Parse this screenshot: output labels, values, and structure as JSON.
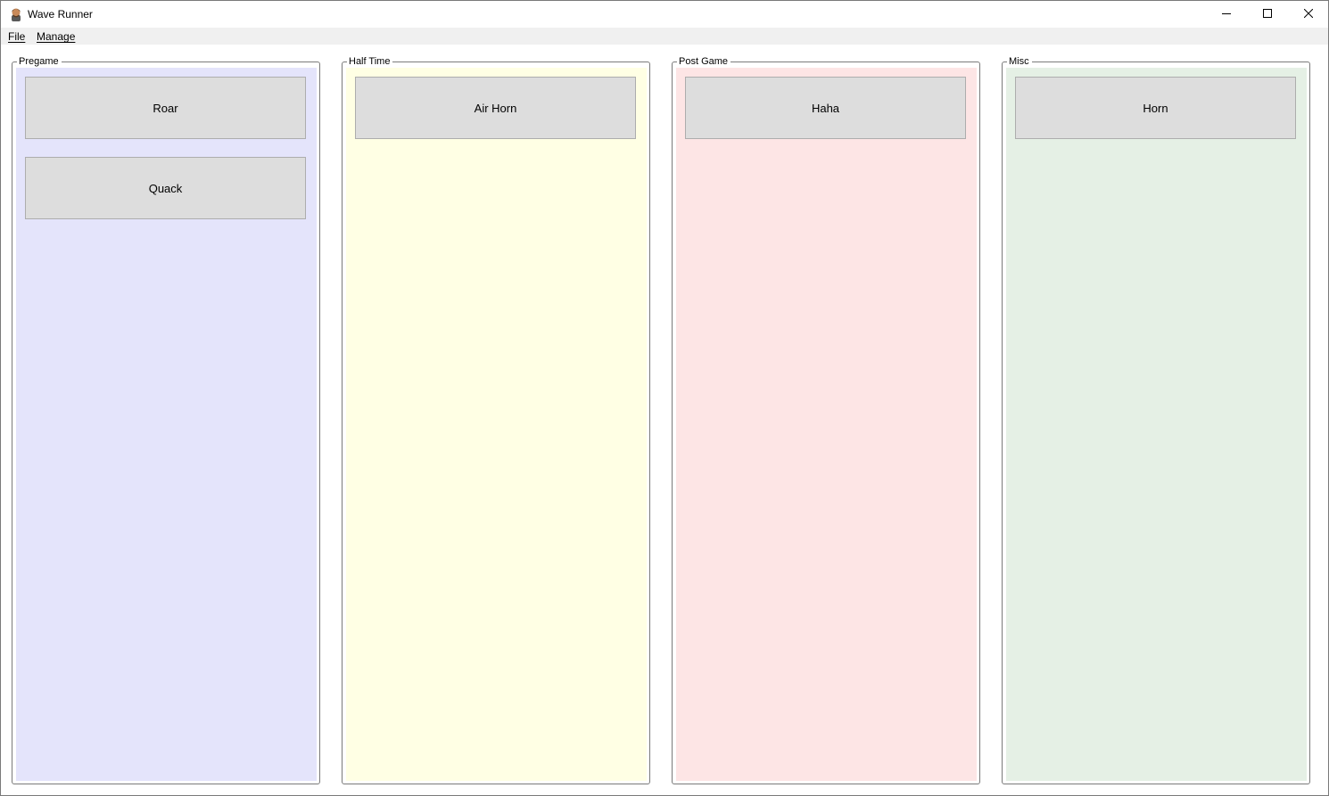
{
  "window": {
    "title": "Wave Runner",
    "icon": "app-logo-icon",
    "controls": {
      "minimize_icon": "minimize-icon",
      "maximize_icon": "maximize-icon",
      "close_icon": "close-icon"
    }
  },
  "menu": {
    "file": "File",
    "manage": "Manage"
  },
  "groups": [
    {
      "label": "Pregame",
      "color": "#e4e4fb",
      "buttons": [
        "Roar",
        "Quack"
      ]
    },
    {
      "label": "Half Time",
      "color": "#ffffe4",
      "buttons": [
        "Air Horn"
      ]
    },
    {
      "label": "Post Game",
      "color": "#fde5e5",
      "buttons": [
        "Haha"
      ]
    },
    {
      "label": "Misc",
      "color": "#e5f0e5",
      "buttons": [
        "Horn"
      ]
    }
  ],
  "colors": {
    "button_bg": "#dddddd",
    "button_border": "#adadad",
    "menubar_bg": "#f0f0f0"
  }
}
